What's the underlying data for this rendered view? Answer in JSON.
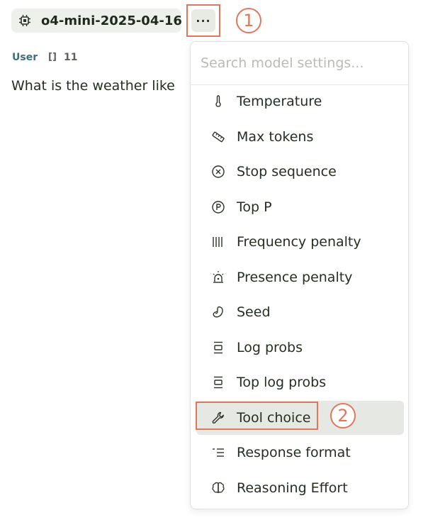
{
  "model": {
    "name": "o4-mini-2025-04-16",
    "icon": "chip-icon"
  },
  "more_button": {
    "label": "···",
    "icon": "more-horizontal-icon"
  },
  "callouts": [
    "1",
    "2"
  ],
  "message": {
    "role": "User",
    "token_icon": "[]",
    "token_count": "11",
    "text": "What is the weather like"
  },
  "settings_menu": {
    "search_placeholder": "Search model settings...",
    "items": [
      {
        "label": "Temperature",
        "icon": "thermometer-icon"
      },
      {
        "label": "Max tokens",
        "icon": "ruler-icon"
      },
      {
        "label": "Stop sequence",
        "icon": "circle-x-icon"
      },
      {
        "label": "Top P",
        "icon": "circle-p-icon"
      },
      {
        "label": "Frequency penalty",
        "icon": "bars-icon"
      },
      {
        "label": "Presence penalty",
        "icon": "siren-icon"
      },
      {
        "label": "Seed",
        "icon": "bean-icon"
      },
      {
        "label": "Log probs",
        "icon": "align-center-icon"
      },
      {
        "label": "Top log probs",
        "icon": "align-center-icon"
      },
      {
        "label": "Tool choice",
        "icon": "wrench-icon",
        "highlighted": true
      },
      {
        "label": "Response format",
        "icon": "list-indent-icon"
      },
      {
        "label": "Reasoning Effort",
        "icon": "brain-icon"
      }
    ]
  },
  "colors": {
    "accent": "#e0775b",
    "user_label": "#3c6e7a",
    "highlight_bg": "#e6e8e3"
  }
}
